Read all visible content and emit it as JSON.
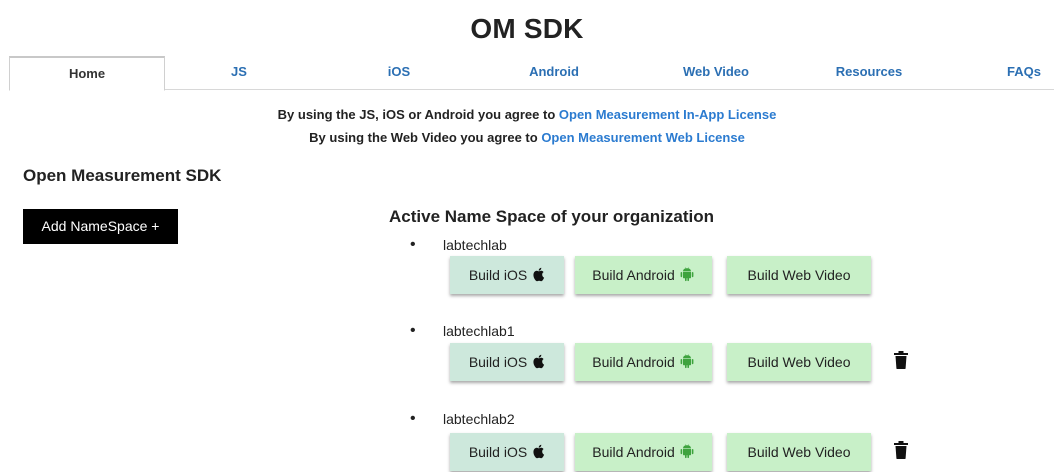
{
  "page": {
    "title": "OM SDK"
  },
  "tabs": [
    {
      "label": "Home",
      "active": true
    },
    {
      "label": "JS"
    },
    {
      "label": "iOS"
    },
    {
      "label": "Android"
    },
    {
      "label": "Web Video"
    },
    {
      "label": "Resources"
    },
    {
      "label": "FAQs"
    }
  ],
  "agreements": [
    {
      "prefix": "By using the JS, iOS or Android you agree to",
      "link": "Open Measurement In-App License"
    },
    {
      "prefix": "By using the Web Video you agree to",
      "link": "Open Measurement Web License"
    }
  ],
  "section_title": "Open Measurement SDK",
  "add_button": "Add NameSpace +",
  "namespaces_heading": "Active Name Space of your organization",
  "namespaces": [
    {
      "name": "labtechlab",
      "deletable": false
    },
    {
      "name": "labtechlab1",
      "deletable": true
    },
    {
      "name": "labtechlab2",
      "deletable": true
    }
  ],
  "build_buttons": {
    "ios": "Build iOS",
    "android": "Build Android",
    "web": "Build Web Video"
  },
  "colors": {
    "link": "#2b7bd0",
    "android_green": "#3ea33e",
    "ios_bg": "#cde8dc",
    "android_bg": "#c8f0c8"
  }
}
